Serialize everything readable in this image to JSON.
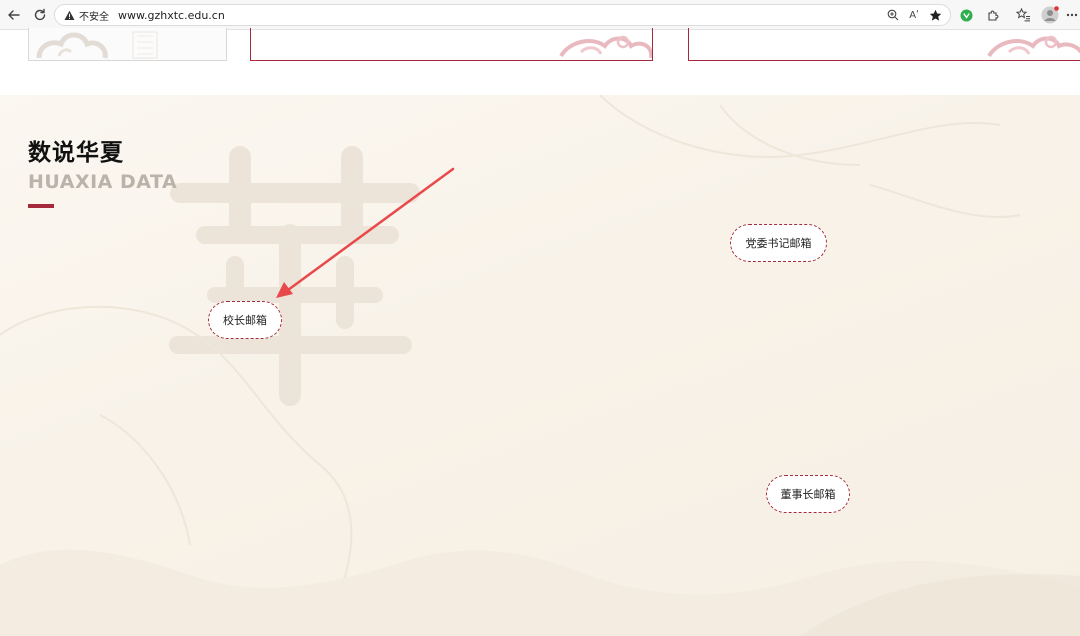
{
  "browser": {
    "security_label": "不安全",
    "url": "www.gzhxtc.edu.cn",
    "icons": [
      "back-icon",
      "reload-icon",
      "warning-icon",
      "zoom-icon",
      "read-aloud-icon",
      "favorite-star-icon",
      "extension-icon",
      "puzzle-icon",
      "favorites-list-icon",
      "profile-avatar-icon",
      "more-icon"
    ],
    "read_aloud_label": "Aʹ"
  },
  "section": {
    "title": "数说华夏",
    "subtitle": "HUAXIA DATA",
    "accent_color": "#a52a3b"
  },
  "mailboxes": {
    "principal": "校长邮箱",
    "party_secretary": "党委书记邮箱",
    "chairman": "董事长邮箱"
  },
  "colors": {
    "brand_red": "#a52a3b",
    "annotation_arrow": "#e8494a",
    "background": "#f8f2e8"
  }
}
